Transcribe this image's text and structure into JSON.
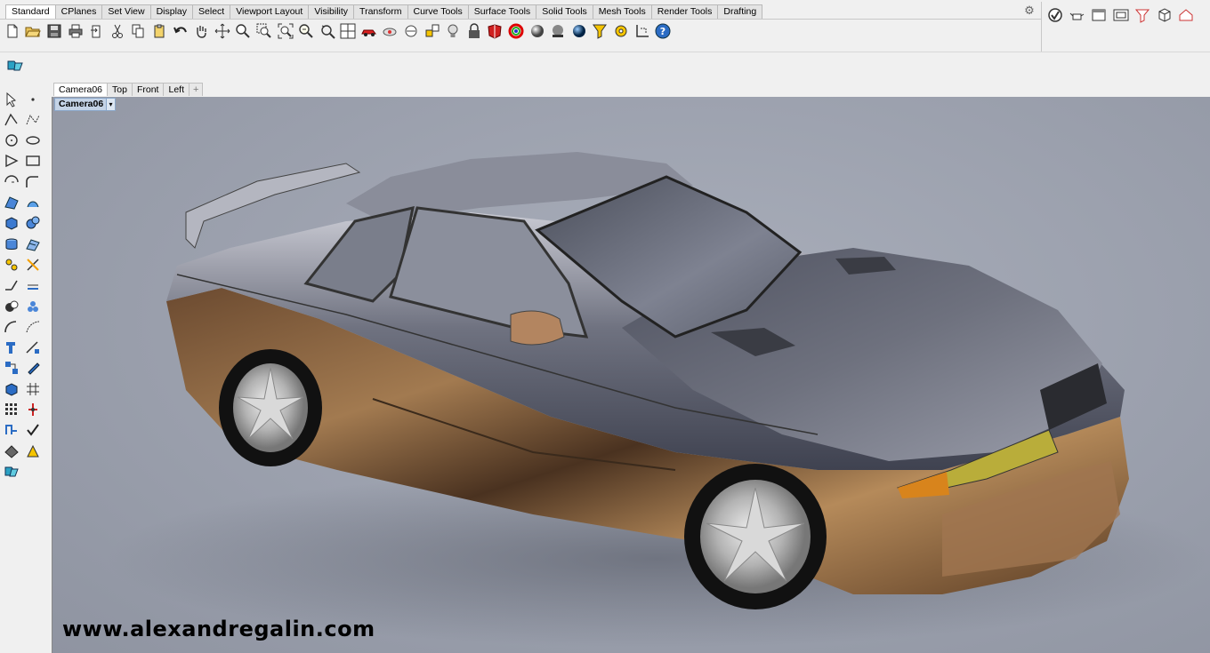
{
  "menu_tabs": [
    "Standard",
    "CPlanes",
    "Set View",
    "Display",
    "Select",
    "Viewport Layout",
    "Visibility",
    "Transform",
    "Curve Tools",
    "Surface Tools",
    "Solid Tools",
    "Mesh Tools",
    "Render Tools",
    "Drafting"
  ],
  "active_menu_tab": "Standard",
  "toolbar_icons": [
    "new-file-icon",
    "open-folder-icon",
    "save-icon",
    "print-icon",
    "import-icon",
    "cut-icon",
    "copy-icon",
    "paste-icon",
    "undo-icon",
    "pan-hand-icon",
    "move-icon",
    "zoom-icon",
    "zoom-window-icon",
    "zoom-extents-icon",
    "zoom-selected-icon",
    "rotate-view-icon",
    "four-viewports-icon",
    "car-icon",
    "hide-icon",
    "point-on-icon",
    "cplane-icon",
    "light-bulb-icon",
    "lock-icon",
    "material-icon",
    "color-wheel-icon",
    "sphere-render-icon",
    "render-icon",
    "globe-icon",
    "funnel-icon",
    "options-icon",
    "snap-grid-icon",
    "help-icon"
  ],
  "right_toolbar_icons": [
    "check-icon",
    "teapot-icon",
    "window-icon",
    "viewport-frame-icon",
    "funnel-red-icon",
    "cube-icon",
    "house-icon"
  ],
  "viewport_tabs": [
    "Camera06",
    "Top",
    "Front",
    "Left"
  ],
  "active_viewport": "Camera06",
  "viewport_title": "Camera06",
  "add_tab_glyph": "+",
  "dropdown_glyph": "▾",
  "watermark": "www.alexandregalin.com",
  "left_tool_icons": [
    "select-arrow-icon",
    "point-icon",
    "polyline-icon",
    "curve-points-icon",
    "circle-icon",
    "ellipse-icon",
    "polygon-icon",
    "rectangle-icon",
    "arc-icon",
    "fillet-curve-icon",
    "surface-icon",
    "loft-icon",
    "box-icon",
    "sphere-icon",
    "cylinder-icon",
    "mesh-icon",
    "explode-icon",
    "trim-icon",
    "extend-icon",
    "offset-icon",
    "boolean-icon",
    "solid-ops-icon",
    "fillet-icon",
    "blend-icon",
    "text-icon",
    "dimension-icon",
    "transform-icon",
    "edit-icon",
    "solid-box-icon",
    "grid-icon",
    "array-icon",
    "gumball-icon",
    "analyze-icon",
    "check-mark-icon",
    "shade-icon",
    "render-tools-icon",
    "command-icon"
  ],
  "colors": {
    "viewport_bg": "#9ba0ad",
    "active_label_bg": "#c4d3e6",
    "toolbar_bg": "#f0f0f0",
    "accent_blue": "#2b6cc4"
  }
}
